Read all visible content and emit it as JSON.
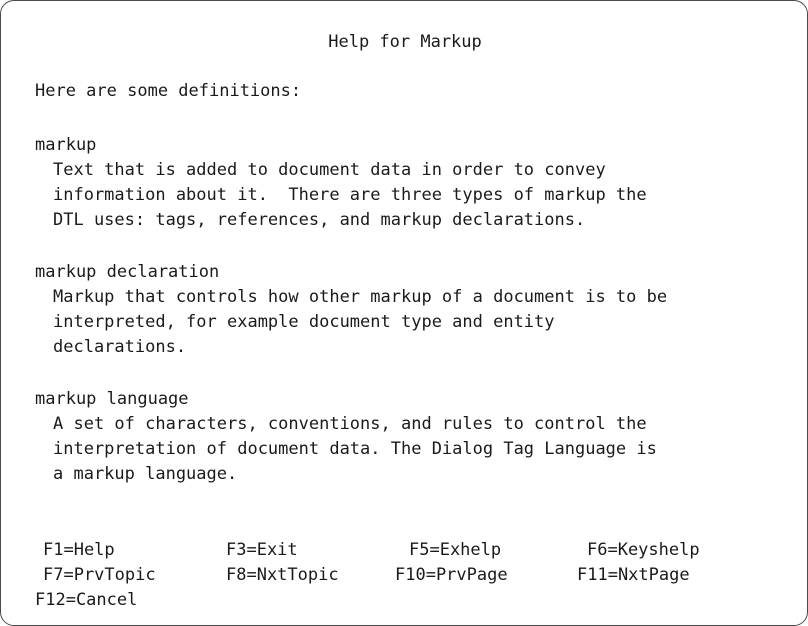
{
  "title": "Help for Markup",
  "intro": "Here are some definitions:",
  "definitions": [
    {
      "term": "markup",
      "lines": [
        "Text that is added to document data in order to convey",
        "information about it.  There are three types of markup the",
        "DTL uses: tags, references, and markup declarations."
      ]
    },
    {
      "term": "markup declaration",
      "lines": [
        "Markup that controls how other markup of a document is to be",
        "interpreted, for example document type and entity",
        "declarations."
      ]
    },
    {
      "term": "markup language",
      "lines": [
        "A set of characters, conventions, and rules to control the",
        "interpretation of document data. The Dialog Tag Language is",
        "a markup language."
      ]
    }
  ],
  "function_keys": [
    "F1=Help",
    "F3=Exit",
    "F5=Exhelp",
    "F6=Keyshelp",
    "F7=PrvTopic",
    "F8=NxtTopic",
    "F10=PrvPage",
    "F11=NxtPage",
    "F12=Cancel"
  ]
}
